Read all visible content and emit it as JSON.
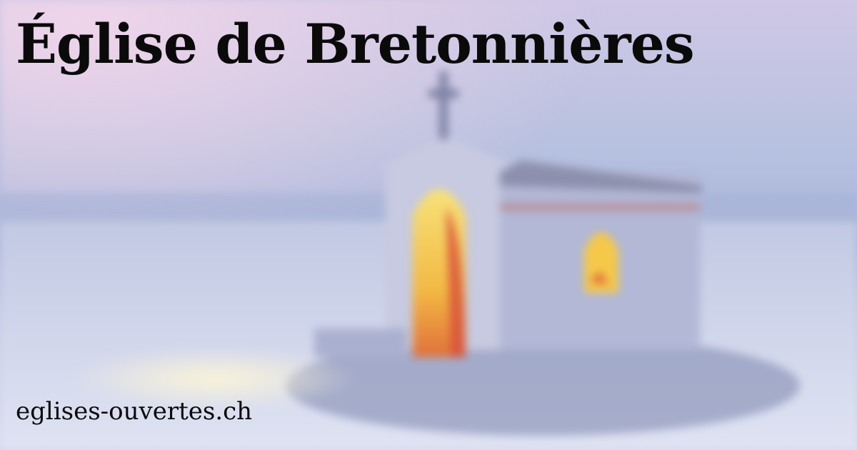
{
  "title": "Église de Bretonnières",
  "site": "eglises-ouvertes.ch",
  "background": {
    "description_colors": {
      "sky": "#b9c2e0",
      "snow": "#d6dcef",
      "chapel": "#c9cbe0",
      "window_glow": "#f5c84a",
      "window_red": "#d8503a"
    }
  }
}
